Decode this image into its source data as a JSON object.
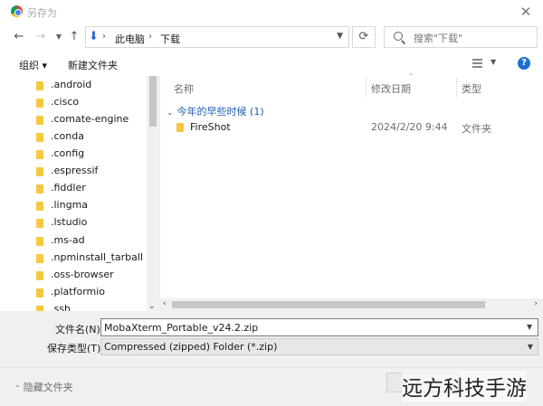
{
  "window": {
    "title": "另存为"
  },
  "nav": {
    "back": "←",
    "forward": "→",
    "recent": "⌄",
    "up": "↑",
    "address": {
      "segments": [
        "此电脑",
        "下载"
      ],
      "separator": "›"
    },
    "refresh": "⟳",
    "search_placeholder": "搜索\"下载\""
  },
  "toolbar": {
    "organize_label": "组织 ▾",
    "new_folder_label": "新建文件夹",
    "help": "?"
  },
  "sidebar": {
    "items": [
      ".android",
      ".cisco",
      ".comate-engine",
      ".conda",
      ".config",
      ".espressif",
      ".fiddler",
      ".lingma",
      ".lstudio",
      ".ms-ad",
      ".npminstall_tarball",
      ".oss-browser",
      ".platformio",
      ".ssh"
    ]
  },
  "columns": {
    "name": "名称",
    "date": "修改日期",
    "type": "类型"
  },
  "group": {
    "label": "今年的早些时候 (1)",
    "chevron": "⌄"
  },
  "files": [
    {
      "name": "FireShot",
      "date": "2024/2/20 9:44",
      "type": "文件夹"
    }
  ],
  "form": {
    "filename_label": "文件名(N):",
    "filename_value": "MobaXterm_Portable_v24.2.zip",
    "filetype_label": "保存类型(T):",
    "filetype_value": "Compressed (zipped) Folder (*.zip)"
  },
  "footer": {
    "hide_folders_label": "隐藏文件夹"
  },
  "watermark": "远方科技手游"
}
